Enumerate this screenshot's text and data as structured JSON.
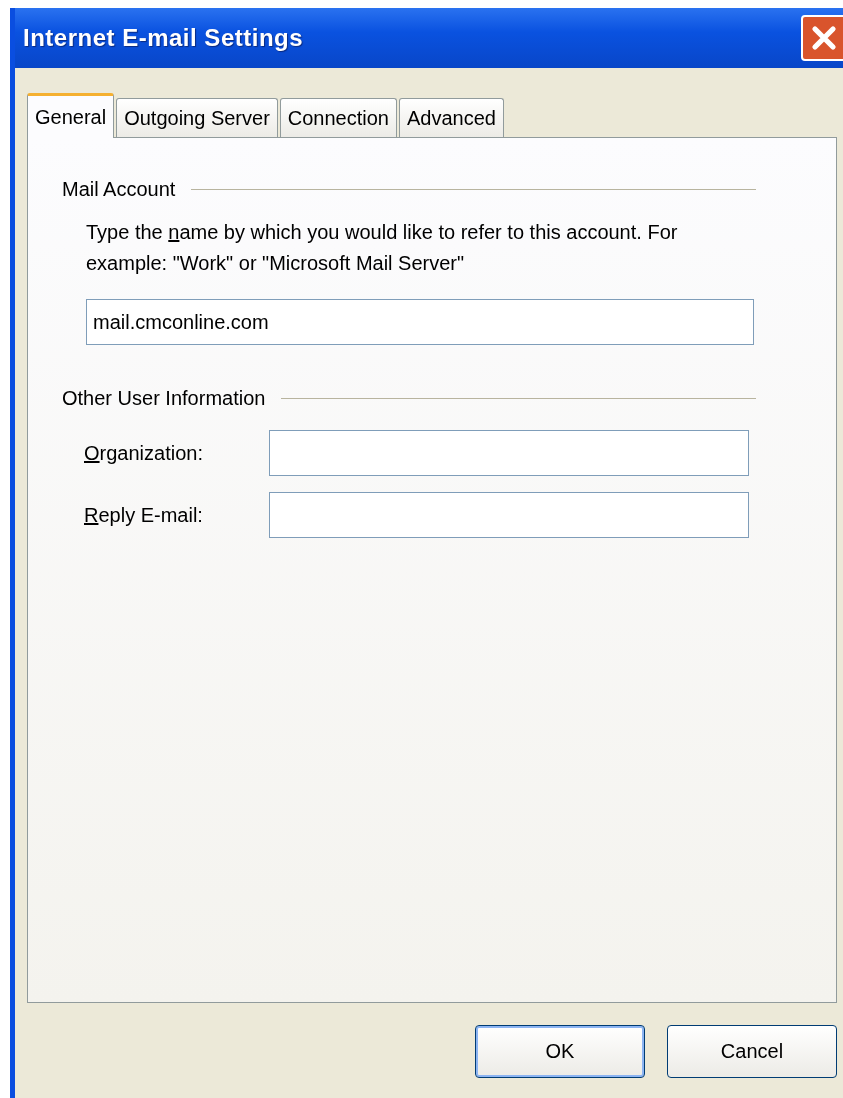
{
  "window": {
    "title": "Internet E-mail Settings"
  },
  "tabs": [
    {
      "label": "General",
      "selected": true
    },
    {
      "label": "Outgoing Server",
      "selected": false
    },
    {
      "label": "Connection",
      "selected": false
    },
    {
      "label": "Advanced",
      "selected": false
    }
  ],
  "mail_account": {
    "heading": "Mail Account",
    "description": {
      "before": "Type the ",
      "access_key": "n",
      "after": "ame by which you would like to refer to this account.  For example: \"Work\" or \"Microsoft Mail Server\""
    },
    "value": "mail.cmconline.com"
  },
  "other_user_information": {
    "heading": "Other User Information",
    "fields": [
      {
        "label": {
          "access_key": "O",
          "after": "rganization:"
        }
      },
      {
        "label": {
          "access_key": "R",
          "after": "eply E-mail:"
        }
      }
    ]
  },
  "buttons": [
    {
      "label": "OK",
      "default": true
    },
    {
      "label": "Cancel",
      "default": false
    }
  ]
}
